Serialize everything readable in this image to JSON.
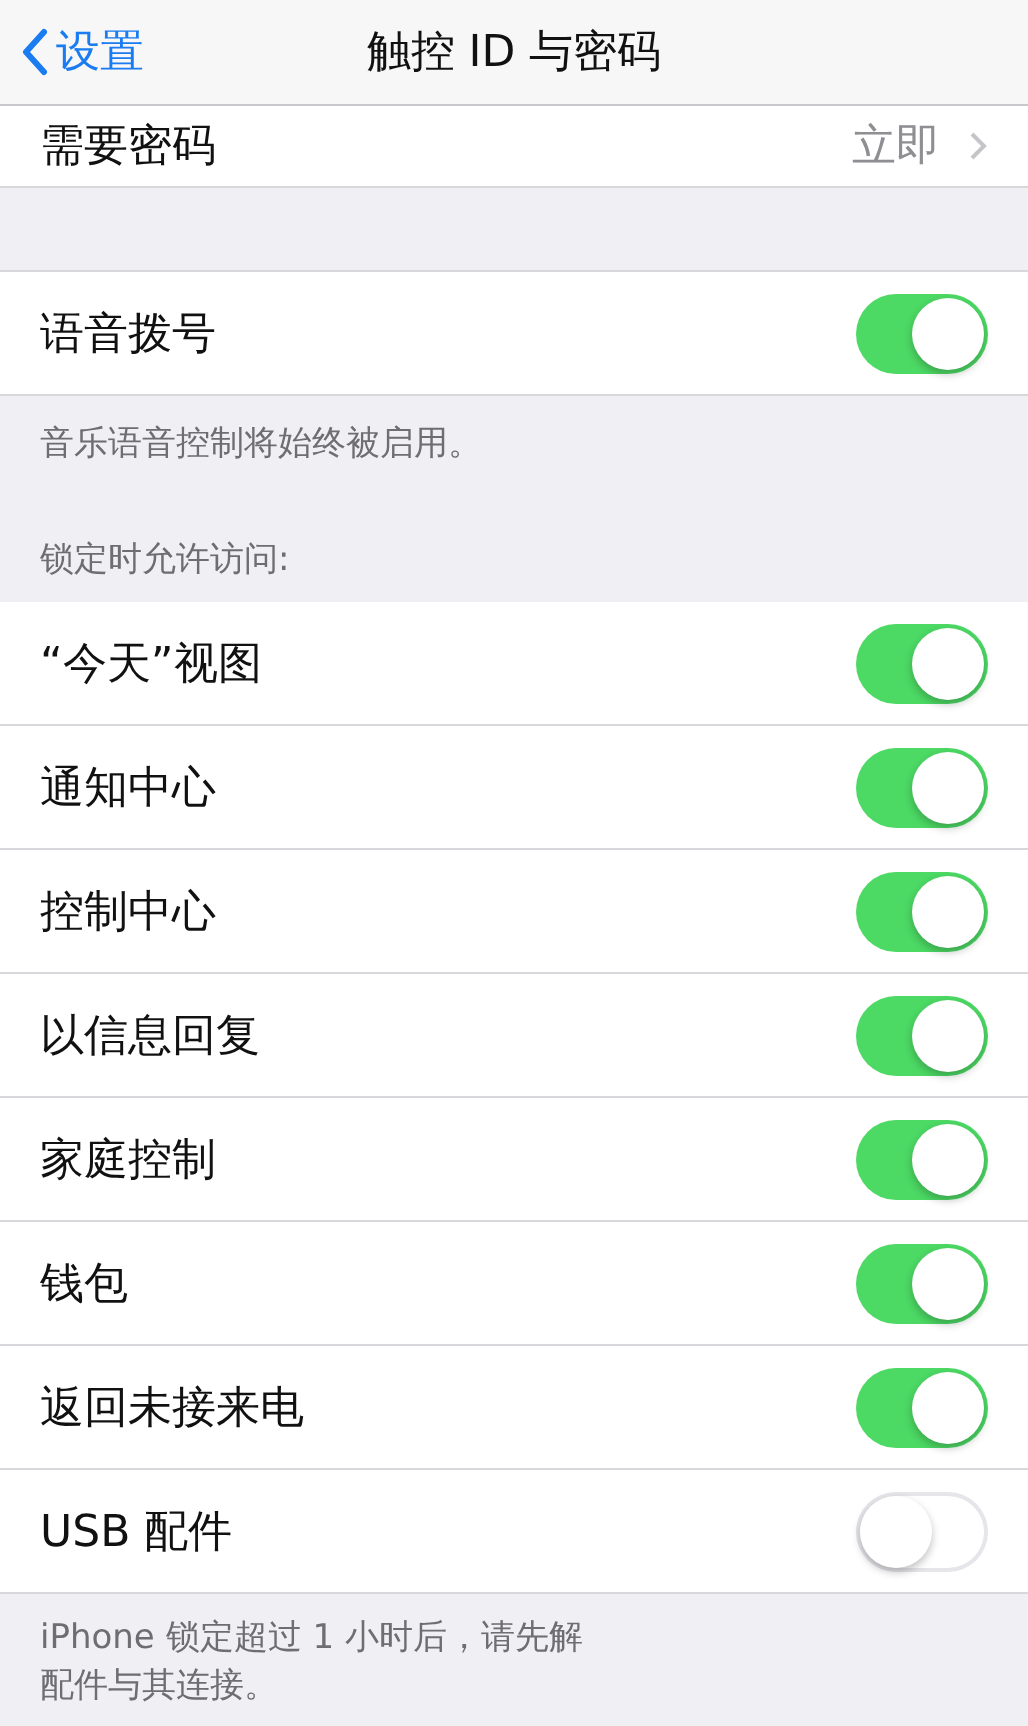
{
  "nav": {
    "back": "设置",
    "title": "触控 ID 与密码"
  },
  "top_row": {
    "label": "需要密码",
    "value": "立即"
  },
  "voice_dial": {
    "label": "语音拨号",
    "on": true
  },
  "voice_note": "音乐语音控制将始终被启用。",
  "lock_header": "锁定时允许访问:",
  "lock_items": [
    {
      "label": "“今天”视图",
      "on": true
    },
    {
      "label": "通知中心",
      "on": true
    },
    {
      "label": "控制中心",
      "on": true
    },
    {
      "label": "以信息回复",
      "on": true
    },
    {
      "label": "家庭控制",
      "on": true
    },
    {
      "label": "钱包",
      "on": true
    },
    {
      "label": "返回未接来电",
      "on": true
    },
    {
      "label": "USB 配件",
      "on": false
    }
  ],
  "footer_lines": [
    "iPhone 锁定超过 1 小时后，请先解",
    "配件与其连接。"
  ]
}
